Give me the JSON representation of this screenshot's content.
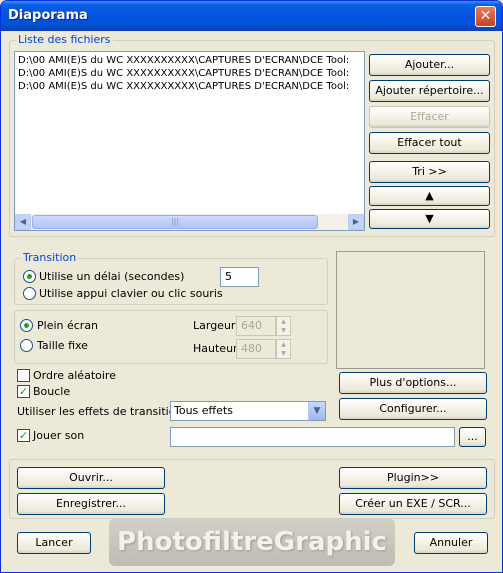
{
  "window": {
    "title": "Diaporama",
    "close_glyph": "✕"
  },
  "files": {
    "group_label": "Liste des fichiers",
    "items": [
      "D:\\00 AMI(E)S du WC XXXXXXXXXX\\CAPTURES D'ECRAN\\DCE Tool:",
      "D:\\00 AMI(E)S du WC XXXXXXXXXX\\CAPTURES D'ECRAN\\DCE Tool:",
      "D:\\00 AMI(E)S du WC XXXXXXXXXX\\CAPTURES D'ECRAN\\DCE Tool:"
    ],
    "buttons": {
      "add": "Ajouter...",
      "add_folder": "Ajouter répertoire...",
      "remove": "Effacer",
      "clear_all": "Effacer tout",
      "sort": "Tri >>",
      "up_glyph": "▲",
      "down_glyph": "▼"
    },
    "scroll": {
      "left": "◀",
      "right": "▶",
      "thumb_grip": "|||"
    }
  },
  "transition": {
    "group_label": "Transition",
    "use_delay_label": "Utilise un délai (secondes)",
    "use_delay_checked": true,
    "delay_value": "5",
    "use_key_label": "Utilise appui clavier ou clic souris",
    "use_key_checked": false
  },
  "display": {
    "fullscreen_label": "Plein écran",
    "fullscreen_checked": true,
    "fixed_size_label": "Taille fixe",
    "fixed_size_checked": false,
    "width_label": "Largeur",
    "width_value": "640",
    "height_label": "Hauteur",
    "height_value": "480"
  },
  "options": {
    "random_label": "Ordre aléatoire",
    "random_checked": false,
    "loop_label": "Boucle",
    "loop_checked": true,
    "effects_label": "Utiliser les effets de transition",
    "effects_value": "Tous effets",
    "sound_label": "Jouer son",
    "sound_checked": true,
    "sound_path": "",
    "browse_label": "...",
    "more_options": "Plus d'options...",
    "configure": "Configurer..."
  },
  "bottom": {
    "open": "Ouvrir...",
    "save": "Enregistrer...",
    "plugin": "Plugin>>",
    "create_exe": "Créer un EXE / SCR...",
    "launch": "Lancer",
    "cancel": "Annuler",
    "watermark": "PhotofiltreGraphic"
  }
}
